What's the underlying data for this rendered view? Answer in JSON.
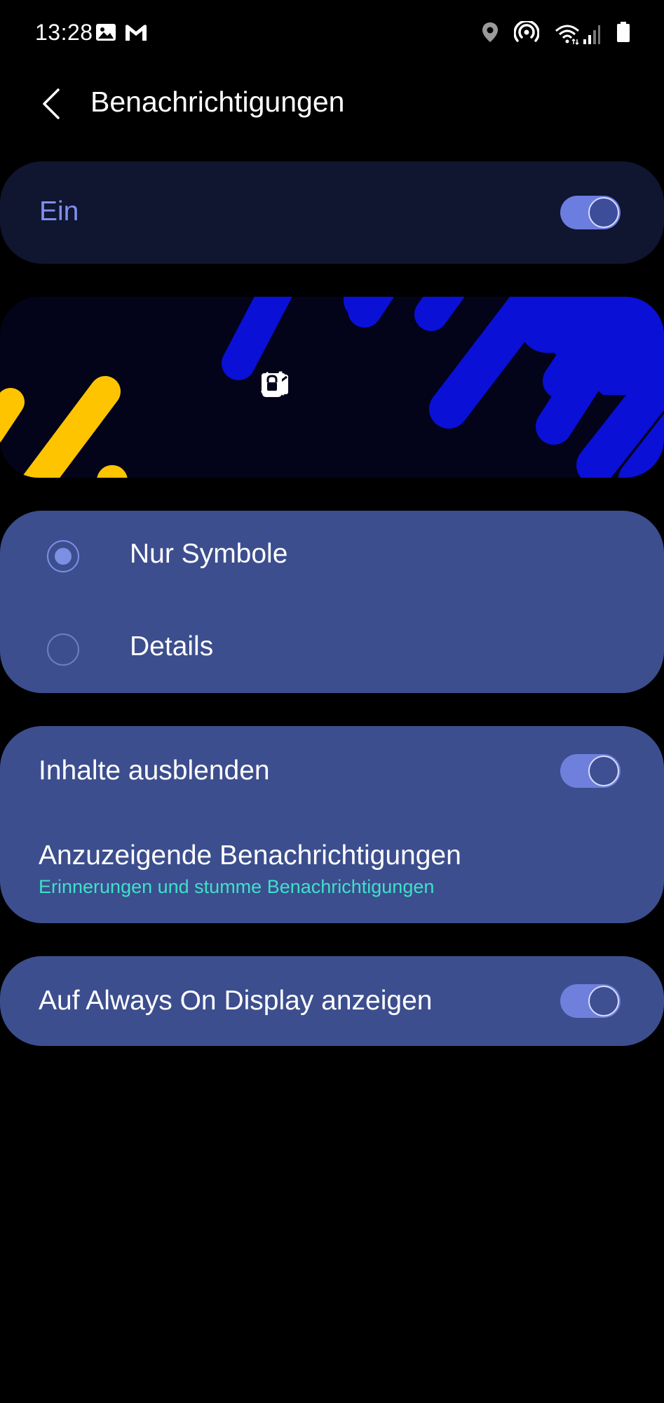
{
  "status_bar": {
    "time": "13:28",
    "left_icons": [
      "gallery-icon",
      "gmail-icon"
    ],
    "right_icons": [
      "location-icon",
      "hotspot-icon",
      "wifi-icon",
      "signal-icon",
      "battery-icon"
    ]
  },
  "header": {
    "title": "Benachrichtigungen",
    "back_icon": "chevron-left-icon"
  },
  "master": {
    "label": "Ein",
    "enabled": true
  },
  "preview": {
    "icons": [
      "missed-call-icon",
      "message-icon",
      "email-icon",
      "lock-icon"
    ],
    "colors": {
      "background": "#03031a",
      "blue": "#0a10d6",
      "yellow": "#ffc400"
    }
  },
  "style_options": {
    "selected": "Nur Symbole",
    "items": [
      {
        "label": "Nur Symbole",
        "checked": true
      },
      {
        "label": "Details",
        "checked": false
      }
    ]
  },
  "options": {
    "hide_content": {
      "label": "Inhalte ausblenden",
      "enabled": true
    },
    "notifications_to_show": {
      "label": "Anzuzeigende Benachrichtigungen",
      "sub": "Erinnerungen und stumme Benachrichtigungen"
    }
  },
  "aod": {
    "label": "Auf Always On Display anzeigen",
    "enabled": true
  },
  "colors": {
    "accent": "#7f8ff0",
    "card": "#3c4e8e",
    "master_card": "#101530",
    "subtext": "#3fe0c9"
  }
}
